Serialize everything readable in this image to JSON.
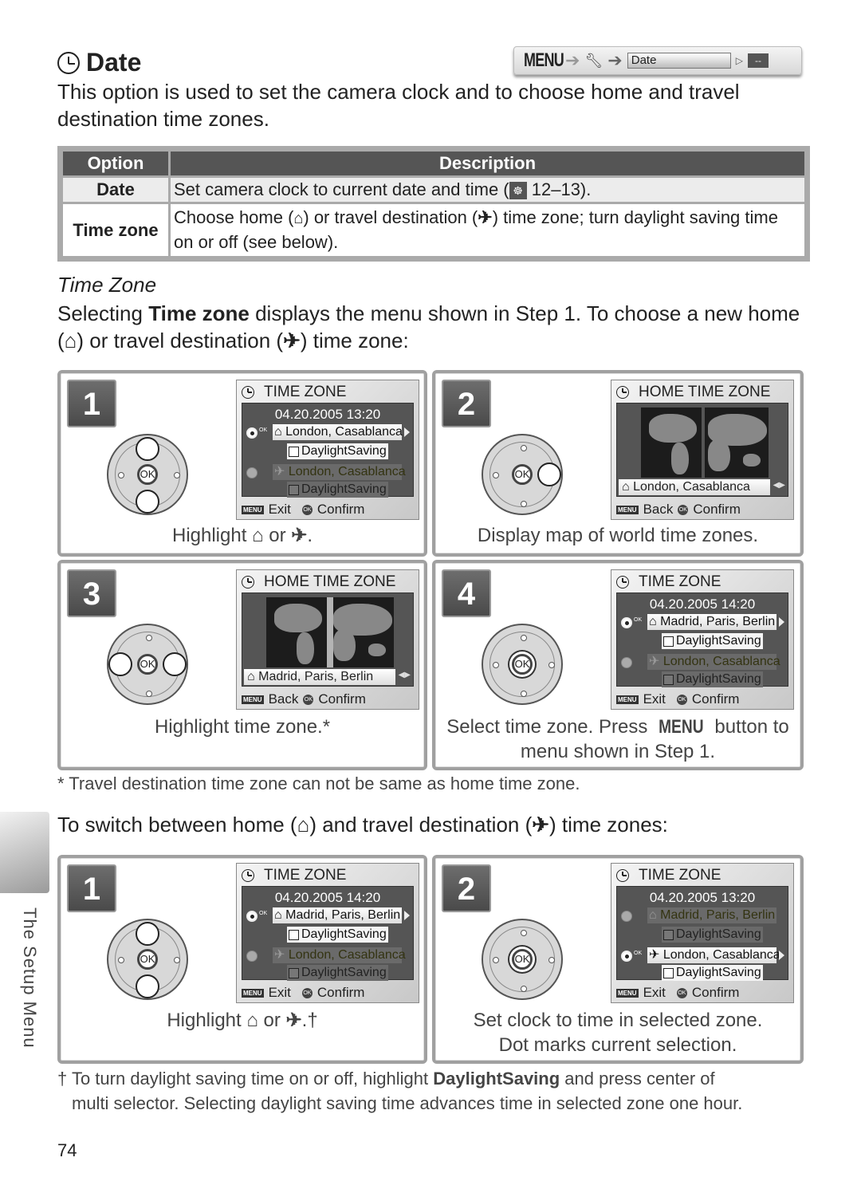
{
  "header": {
    "icon": "clock-icon",
    "title": "Date",
    "menu_path": {
      "menu_label": "MENU",
      "arrow": "➔",
      "setup_icon": "wrench-icon",
      "field_label": "Date",
      "value": "--"
    }
  },
  "intro": "This option is used to set the camera clock and to choose home and travel destination time zones.",
  "option_table": {
    "headers": [
      "Option",
      "Description"
    ],
    "rows": [
      {
        "option": "Date",
        "description_pre": "Set camera clock to current date and time (",
        "page_ref_icon": "page-reference-icon",
        "description_post": " 12–13)."
      },
      {
        "option": "Time zone",
        "description_pre": "Choose home (",
        "home_icon": "home-icon",
        "description_mid": ") or travel destination (",
        "travel_icon": "airplane-icon",
        "description_post": ") time zone; turn daylight saving time on or off (see below)."
      }
    ]
  },
  "time_zone_section": {
    "heading": "Time Zone",
    "para_pre": "Selecting ",
    "para_bold": "Time zone",
    "para_post1": " displays the menu shown in Step 1.  To choose a new home (",
    "para_post2": ") or travel destination (",
    "para_post3": ") time zone:"
  },
  "glyphs": {
    "home": "⌂",
    "plane": "✈",
    "page_ref": "☸"
  },
  "steps_a": [
    {
      "number": "1",
      "screen": {
        "title": "TIME ZONE",
        "date": "04.20.2005   13:20",
        "home_zone": "London, Casablanca",
        "travel_zone": "London, Casablanca",
        "daylight": "DaylightSaving",
        "selected": "home",
        "footer_left": "Exit",
        "footer_right": "Confirm"
      },
      "caption_pre": "Highlight ",
      "caption_mid": " or ",
      "caption_post": "."
    },
    {
      "number": "2",
      "screen": {
        "title": "HOME TIME ZONE",
        "zone": "London, Casablanca",
        "footer_left": "Back",
        "footer_right": "Confirm"
      },
      "caption": "Display map of world time zones."
    },
    {
      "number": "3",
      "screen": {
        "title": "HOME TIME ZONE",
        "zone": "Madrid, Paris, Berlin",
        "footer_left": "Back",
        "footer_right": "Confirm"
      },
      "caption": "Highlight time zone.*"
    },
    {
      "number": "4",
      "screen": {
        "title": "TIME ZONE",
        "date": "04.20.2005   14:20",
        "home_zone": "Madrid, Paris, Berlin",
        "travel_zone": "London, Casablanca",
        "daylight": "DaylightSaving",
        "selected": "home",
        "footer_left": "Exit",
        "footer_right": "Confirm"
      },
      "caption_pre": "Select time zone.  Press ",
      "caption_bold": "MENU",
      "caption_post": " button to menu shown in Step 1."
    }
  ],
  "footnote_star": "* Travel destination time zone can not be same as home time zone.",
  "switch_section": {
    "pre": "To switch between home (",
    "mid": ") and travel destination (",
    "post": ") time zones:"
  },
  "steps_b": [
    {
      "number": "1",
      "screen": {
        "title": "TIME ZONE",
        "date": "04.20.2005   14:20",
        "home_zone": "Madrid, Paris, Berlin",
        "travel_zone": "London, Casablanca",
        "daylight": "DaylightSaving",
        "selected": "home",
        "footer_left": "Exit",
        "footer_right": "Confirm"
      },
      "caption_pre": "Highlight ",
      "caption_mid": " or ",
      "caption_post": ".†"
    },
    {
      "number": "2",
      "screen": {
        "title": "TIME ZONE",
        "date": "04.20.2005   13:20",
        "home_zone": "Madrid, Paris, Berlin",
        "travel_zone": "London, Casablanca",
        "daylight": "DaylightSaving",
        "selected": "travel",
        "footer_left": "Exit",
        "footer_right": "Confirm"
      },
      "caption_line1": "Set clock to time in selected zone.",
      "caption_line2": "Dot marks current selection."
    }
  ],
  "footnote_dagger": {
    "pre": "† To turn daylight saving time on or off, highlight ",
    "bold": "DaylightSaving",
    "post": " and press center of",
    "line2": "multi selector.  Selecting daylight saving time advances time in selected zone one hour."
  },
  "side_tab": {
    "label": "The Setup Menu"
  },
  "page_number": "74",
  "labels": {
    "menu_icon": "MENU",
    "ok_icon": "OK",
    "ok_small": "OK"
  }
}
